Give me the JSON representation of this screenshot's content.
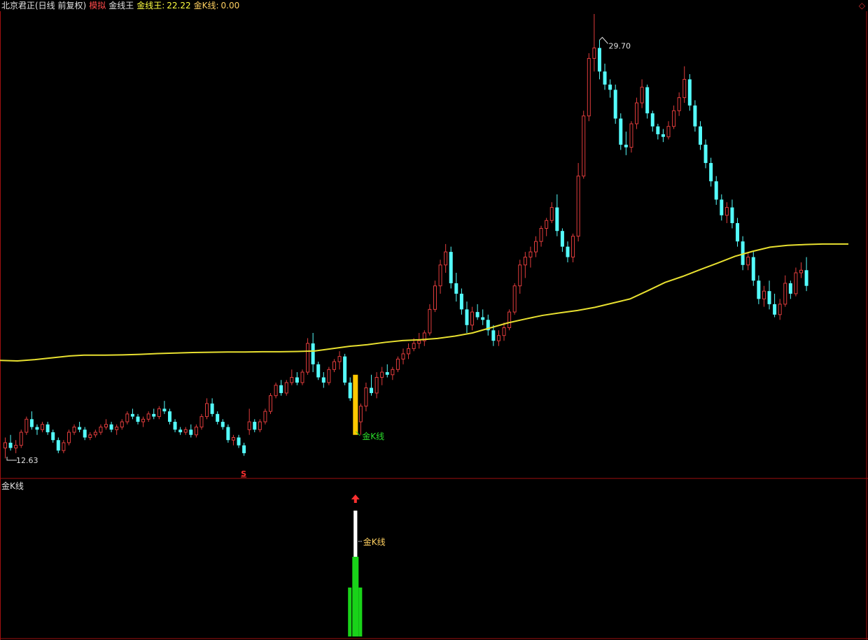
{
  "header": {
    "stock_name": "北京君正(日线 前复权)",
    "mode": "模拟",
    "indicator_name": "金线王",
    "ind_label": "金线王:",
    "ind_value": "22.22",
    "kline_label": "金K线:",
    "kline_value": "0.00",
    "corner_icon": "diamond-icon"
  },
  "sub_panel": {
    "title": "金K线",
    "annotation": "金K线"
  },
  "annotations": {
    "high_label": "29.70",
    "low_label": "12.63",
    "signal_label": "金K线",
    "marker_s": "S"
  },
  "colors": {
    "up": "#e03c3c",
    "down": "#54fcfc",
    "ma": "#e8e030",
    "signal": "#ffc800",
    "green": "#19d319",
    "border": "#a01010",
    "text": "#e0e0e0"
  },
  "chart_data": {
    "type": "candlestick",
    "ylim": [
      12.0,
      30.5
    ],
    "candles": [
      [
        13.1,
        13.5,
        12.7,
        13.3
      ],
      [
        13.3,
        13.6,
        13.0,
        13.1
      ],
      [
        13.1,
        13.4,
        12.9,
        13.2
      ],
      [
        13.2,
        13.8,
        13.1,
        13.7
      ],
      [
        13.7,
        14.3,
        13.6,
        14.2
      ],
      [
        14.2,
        14.5,
        13.8,
        13.9
      ],
      [
        13.9,
        14.0,
        13.6,
        13.8
      ],
      [
        13.8,
        14.1,
        13.7,
        14.0
      ],
      [
        14.0,
        14.1,
        13.6,
        13.7
      ],
      [
        13.7,
        13.8,
        13.3,
        13.4
      ],
      [
        13.4,
        13.5,
        12.9,
        13.0
      ],
      [
        13.0,
        13.4,
        12.9,
        13.3
      ],
      [
        13.3,
        13.8,
        13.2,
        13.7
      ],
      [
        13.7,
        14.0,
        13.6,
        13.9
      ],
      [
        13.9,
        14.1,
        13.7,
        13.8
      ],
      [
        13.8,
        13.9,
        13.4,
        13.5
      ],
      [
        13.5,
        13.7,
        13.4,
        13.6
      ],
      [
        13.6,
        13.8,
        13.5,
        13.7
      ],
      [
        13.7,
        14.0,
        13.6,
        13.9
      ],
      [
        13.9,
        14.2,
        13.8,
        14.0
      ],
      [
        14.0,
        14.1,
        13.7,
        13.8
      ],
      [
        13.8,
        14.0,
        13.6,
        13.9
      ],
      [
        13.9,
        14.2,
        13.8,
        14.1
      ],
      [
        14.1,
        14.5,
        14.0,
        14.4
      ],
      [
        14.4,
        14.6,
        14.2,
        14.3
      ],
      [
        14.3,
        14.4,
        14.0,
        14.1
      ],
      [
        14.1,
        14.3,
        13.9,
        14.2
      ],
      [
        14.2,
        14.5,
        14.1,
        14.4
      ],
      [
        14.4,
        14.6,
        14.2,
        14.3
      ],
      [
        14.3,
        14.7,
        14.2,
        14.6
      ],
      [
        14.6,
        14.9,
        14.4,
        14.5
      ],
      [
        14.5,
        14.6,
        14.0,
        14.1
      ],
      [
        14.1,
        14.2,
        13.7,
        13.8
      ],
      [
        13.8,
        13.9,
        13.6,
        13.7
      ],
      [
        13.7,
        13.9,
        13.6,
        13.8
      ],
      [
        13.8,
        14.0,
        13.5,
        13.6
      ],
      [
        13.6,
        14.0,
        13.5,
        13.9
      ],
      [
        13.9,
        14.4,
        13.8,
        14.3
      ],
      [
        14.3,
        15.0,
        14.2,
        14.8
      ],
      [
        14.8,
        15.0,
        14.3,
        14.4
      ],
      [
        14.4,
        14.5,
        14.0,
        14.1
      ],
      [
        14.1,
        14.2,
        13.8,
        13.9
      ],
      [
        13.9,
        14.0,
        13.3,
        13.4
      ],
      [
        13.4,
        13.6,
        13.2,
        13.5
      ],
      [
        13.5,
        13.6,
        13.1,
        13.2
      ],
      [
        13.2,
        13.3,
        12.8,
        12.9
      ],
      [
        13.8,
        14.6,
        13.6,
        14.1
      ],
      [
        14.1,
        14.2,
        13.7,
        13.8
      ],
      [
        13.8,
        14.2,
        13.7,
        14.1
      ],
      [
        14.1,
        14.6,
        14.0,
        14.5
      ],
      [
        14.5,
        15.2,
        14.4,
        15.1
      ],
      [
        15.1,
        15.6,
        15.0,
        15.5
      ],
      [
        15.5,
        15.7,
        15.1,
        15.2
      ],
      [
        15.2,
        15.7,
        15.1,
        15.6
      ],
      [
        15.6,
        16.1,
        15.5,
        15.8
      ],
      [
        15.8,
        16.0,
        15.5,
        15.6
      ],
      [
        15.6,
        16.1,
        15.5,
        16.0
      ],
      [
        16.0,
        17.3,
        15.9,
        17.1
      ],
      [
        17.1,
        17.5,
        16.0,
        16.3
      ],
      [
        16.3,
        16.4,
        15.7,
        15.8
      ],
      [
        15.8,
        16.0,
        15.4,
        15.6
      ],
      [
        15.6,
        16.2,
        15.5,
        16.1
      ],
      [
        16.1,
        16.5,
        16.0,
        16.4
      ],
      [
        16.4,
        16.8,
        16.1,
        16.6
      ],
      [
        16.6,
        16.7,
        15.5,
        15.6
      ],
      [
        15.6,
        15.8,
        14.9,
        15.0
      ],
      [
        15.0,
        15.1,
        14.0,
        14.1
      ],
      [
        14.1,
        14.8,
        13.6,
        14.7
      ],
      [
        14.7,
        15.6,
        14.5,
        15.4
      ],
      [
        15.4,
        15.9,
        15.1,
        15.2
      ],
      [
        15.2,
        16.0,
        15.0,
        15.8
      ],
      [
        15.8,
        16.2,
        15.5,
        16.0
      ],
      [
        16.0,
        16.3,
        15.8,
        15.9
      ],
      [
        15.9,
        16.2,
        15.7,
        16.1
      ],
      [
        16.1,
        16.6,
        16.0,
        16.5
      ],
      [
        16.5,
        16.9,
        16.3,
        16.7
      ],
      [
        16.7,
        17.1,
        16.5,
        16.9
      ],
      [
        16.9,
        17.3,
        16.8,
        17.1
      ],
      [
        17.1,
        17.5,
        16.9,
        17.2
      ],
      [
        17.2,
        17.6,
        17.0,
        17.5
      ],
      [
        17.5,
        18.6,
        17.4,
        18.4
      ],
      [
        18.4,
        19.5,
        18.3,
        19.3
      ],
      [
        19.3,
        20.3,
        19.0,
        20.1
      ],
      [
        20.1,
        20.9,
        19.8,
        20.6
      ],
      [
        20.6,
        20.8,
        19.2,
        19.4
      ],
      [
        19.4,
        19.8,
        18.7,
        19.0
      ],
      [
        19.0,
        19.2,
        18.2,
        18.4
      ],
      [
        18.4,
        18.7,
        17.5,
        17.8
      ],
      [
        17.8,
        18.5,
        17.6,
        18.3
      ],
      [
        18.3,
        18.6,
        18.0,
        18.1
      ],
      [
        18.1,
        18.4,
        17.8,
        18.0
      ],
      [
        18.0,
        18.2,
        17.4,
        17.6
      ],
      [
        17.6,
        17.8,
        17.0,
        17.2
      ],
      [
        17.2,
        17.6,
        17.0,
        17.4
      ],
      [
        17.4,
        17.9,
        17.2,
        17.7
      ],
      [
        17.7,
        18.4,
        17.6,
        18.3
      ],
      [
        18.3,
        19.4,
        18.2,
        19.3
      ],
      [
        19.3,
        20.3,
        19.0,
        20.1
      ],
      [
        20.1,
        20.6,
        19.6,
        20.4
      ],
      [
        20.4,
        20.8,
        20.0,
        20.6
      ],
      [
        20.6,
        21.2,
        20.4,
        21.0
      ],
      [
        21.0,
        21.6,
        20.8,
        21.5
      ],
      [
        21.5,
        21.9,
        21.2,
        21.8
      ],
      [
        21.8,
        22.5,
        21.7,
        22.3
      ],
      [
        22.3,
        22.8,
        21.2,
        21.4
      ],
      [
        21.4,
        21.5,
        20.6,
        20.8
      ],
      [
        20.8,
        21.0,
        20.2,
        20.4
      ],
      [
        20.4,
        21.3,
        20.2,
        21.2
      ],
      [
        21.2,
        24.0,
        21.0,
        23.5
      ],
      [
        23.5,
        26.0,
        23.4,
        25.8
      ],
      [
        25.8,
        28.2,
        25.6,
        28.0
      ],
      [
        28.0,
        29.7,
        27.5,
        28.4
      ],
      [
        28.4,
        28.7,
        27.2,
        27.5
      ],
      [
        27.5,
        27.8,
        26.8,
        27.0
      ],
      [
        27.0,
        27.2,
        26.5,
        26.8
      ],
      [
        26.8,
        27.0,
        25.5,
        25.7
      ],
      [
        25.7,
        25.9,
        24.5,
        24.7
      ],
      [
        24.7,
        25.2,
        24.3,
        24.6
      ],
      [
        24.6,
        25.6,
        24.4,
        25.5
      ],
      [
        25.5,
        26.5,
        25.3,
        26.3
      ],
      [
        26.3,
        27.2,
        26.1,
        26.9
      ],
      [
        26.9,
        27.0,
        25.7,
        25.9
      ],
      [
        25.9,
        26.0,
        25.2,
        25.4
      ],
      [
        25.4,
        25.5,
        24.9,
        25.1
      ],
      [
        25.1,
        25.3,
        24.8,
        25.0
      ],
      [
        25.0,
        25.6,
        24.9,
        25.4
      ],
      [
        25.4,
        26.2,
        25.3,
        26.0
      ],
      [
        26.0,
        26.7,
        25.8,
        26.5
      ],
      [
        26.5,
        27.7,
        26.3,
        27.2
      ],
      [
        27.2,
        27.4,
        26.0,
        26.2
      ],
      [
        26.2,
        26.4,
        25.2,
        25.4
      ],
      [
        25.4,
        25.6,
        24.5,
        24.7
      ],
      [
        24.7,
        24.9,
        23.8,
        24.0
      ],
      [
        24.0,
        24.2,
        23.1,
        23.3
      ],
      [
        23.3,
        23.5,
        22.4,
        22.6
      ],
      [
        22.6,
        22.8,
        21.8,
        22.0
      ],
      [
        22.0,
        22.5,
        21.7,
        22.3
      ],
      [
        22.3,
        22.6,
        21.5,
        21.7
      ],
      [
        21.7,
        21.9,
        20.8,
        21.0
      ],
      [
        21.0,
        21.2,
        19.9,
        20.1
      ],
      [
        20.1,
        20.6,
        19.9,
        20.4
      ],
      [
        20.4,
        20.6,
        19.3,
        19.5
      ],
      [
        19.5,
        19.7,
        18.6,
        18.8
      ],
      [
        18.8,
        19.3,
        18.5,
        19.1
      ],
      [
        19.1,
        19.5,
        18.4,
        18.6
      ],
      [
        18.6,
        19.0,
        18.1,
        18.2
      ],
      [
        18.2,
        18.8,
        18.0,
        18.6
      ],
      [
        18.6,
        19.7,
        18.5,
        19.4
      ],
      [
        19.4,
        19.5,
        18.8,
        19.0
      ],
      [
        19.0,
        20.0,
        18.9,
        19.8
      ],
      [
        19.8,
        20.2,
        19.6,
        19.9
      ],
      [
        19.9,
        20.4,
        19.1,
        19.3
      ]
    ],
    "ma": [
      [
        0,
        16.45
      ],
      [
        25,
        16.43
      ],
      [
        50,
        16.48
      ],
      [
        75,
        16.55
      ],
      [
        100,
        16.62
      ],
      [
        120,
        16.65
      ],
      [
        150,
        16.65
      ],
      [
        175,
        16.66
      ],
      [
        200,
        16.68
      ],
      [
        225,
        16.71
      ],
      [
        250,
        16.73
      ],
      [
        275,
        16.75
      ],
      [
        300,
        16.76
      ],
      [
        325,
        16.77
      ],
      [
        350,
        16.77
      ],
      [
        375,
        16.78
      ],
      [
        400,
        16.78
      ],
      [
        425,
        16.79
      ],
      [
        450,
        16.81
      ],
      [
        475,
        16.9
      ],
      [
        500,
        16.99
      ],
      [
        525,
        17.05
      ],
      [
        550,
        17.14
      ],
      [
        575,
        17.21
      ],
      [
        600,
        17.24
      ],
      [
        625,
        17.29
      ],
      [
        650,
        17.38
      ],
      [
        675,
        17.5
      ],
      [
        700,
        17.69
      ],
      [
        725,
        17.88
      ],
      [
        750,
        18.03
      ],
      [
        775,
        18.17
      ],
      [
        800,
        18.27
      ],
      [
        825,
        18.36
      ],
      [
        850,
        18.48
      ],
      [
        875,
        18.64
      ],
      [
        900,
        18.8
      ],
      [
        925,
        19.11
      ],
      [
        950,
        19.43
      ],
      [
        975,
        19.66
      ],
      [
        1000,
        19.92
      ],
      [
        1025,
        20.17
      ],
      [
        1050,
        20.43
      ],
      [
        1075,
        20.62
      ],
      [
        1100,
        20.78
      ],
      [
        1125,
        20.85
      ],
      [
        1150,
        20.88
      ],
      [
        1175,
        20.9
      ],
      [
        1200,
        20.9
      ],
      [
        1212,
        20.9
      ]
    ],
    "signal_index": 66,
    "low_index": 10,
    "high_index": 112,
    "s_index": 45,
    "sub_bars": [
      {
        "index": 65,
        "value": 1.0,
        "color": "green"
      },
      {
        "index": 66,
        "value": 1.0,
        "color": "white"
      },
      {
        "index": 67,
        "value": 1.0,
        "color": "green"
      }
    ]
  }
}
